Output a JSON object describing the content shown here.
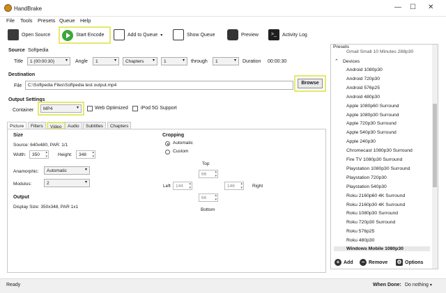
{
  "window": {
    "title": "HandBrake",
    "minimize": "—",
    "maximize": "☐",
    "close": "✕"
  },
  "menu": [
    "File",
    "Tools",
    "Presets",
    "Queue",
    "Help"
  ],
  "toolbar": {
    "open_source": "Open Source",
    "start_encode": "Start Encode",
    "add_to_queue": "Add to Queue",
    "show_queue": "Show Queue",
    "preview": "Preview",
    "activity_log": "Activity Log"
  },
  "source": {
    "heading": "Source",
    "name": "Softpedia",
    "title_label": "Title",
    "title_value": "1 (00:00:30)",
    "angle_label": "Angle",
    "angle_value": "1",
    "range_type": "Chapters",
    "range_start": "1",
    "through_label": "through",
    "range_end": "1",
    "duration_label": "Duration",
    "duration_value": "00:00:30"
  },
  "destination": {
    "heading": "Destination",
    "file_label": "File",
    "file_value": "C:\\Softpedia Files\\Softpedia test output.mp4",
    "browse": "Browse"
  },
  "output_settings": {
    "heading": "Output Settings",
    "container_label": "Container",
    "container_value": "MP4",
    "web_optimized": "Web Optimized",
    "ipod": "iPod 5G Support"
  },
  "tabs": [
    "Picture",
    "Filters",
    "Video",
    "Audio",
    "Subtitles",
    "Chapters"
  ],
  "picture": {
    "size_heading": "Size",
    "source_line": "Source:  640x480, PAR: 1/1",
    "width_label": "Width:",
    "width_value": "350",
    "height_label": "Height:",
    "height_value": "348",
    "anamorphic_label": "Anamorphic:",
    "anamorphic_value": "Automatic",
    "modulus_label": "Modulus:",
    "modulus_value": "2",
    "output_heading": "Output",
    "display_size": "Display Size: 350x348,  PAR 1x1",
    "cropping_heading": "Cropping",
    "crop_auto": "Automatic",
    "crop_custom": "Custom",
    "top_label": "Top",
    "top_value": "66",
    "left_label": "Left",
    "left_value": "144",
    "right_value": "146",
    "right_label": "Right",
    "bottom_value": "66",
    "bottom_label": "Bottom"
  },
  "presets": {
    "heading": "Presets",
    "partial_top": "Gmail Small 10 Minutes 288p30",
    "group": "Devices",
    "items": [
      "Android 1080p30",
      "Android 720p30",
      "Android 576p25",
      "Android 480p30",
      "Apple 1080p60 Surround",
      "Apple 1080p30 Surround",
      "Apple 720p30 Surround",
      "Apple 540p30 Surround",
      "Apple 240p30",
      "Chromecast 1080p30 Surround",
      "Fire TV 1080p30 Surround",
      "Playstation 1080p30 Surround",
      "Playstation 720p30",
      "Playstation 540p30",
      "Roku 2160p60 4K Surround",
      "Roku 2160p30 4K Surround",
      "Roku 1080p30 Surround",
      "Roku 720p30 Surround",
      "Roku 576p25",
      "Roku 480p30"
    ],
    "selected": "Windows Mobile 1080p30",
    "add": "Add",
    "remove": "Remove",
    "options": "Options"
  },
  "status": {
    "text": "Ready",
    "when_done_label": "When Done:",
    "when_done_value": "Do nothing"
  },
  "colors": {
    "highlight": "#e4e96b",
    "play_green": "#3fa63a"
  }
}
